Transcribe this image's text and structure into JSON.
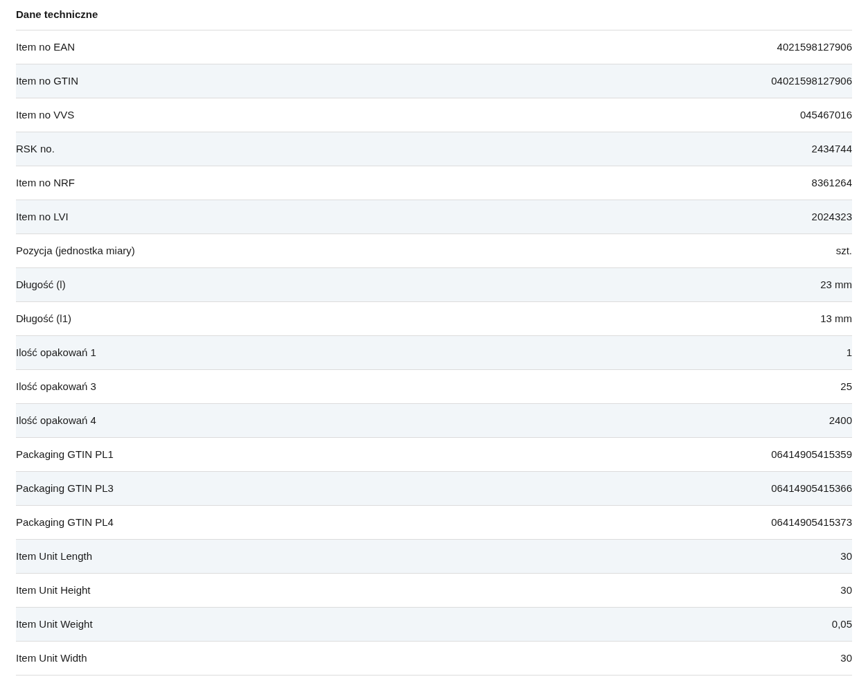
{
  "title": "Dane techniczne",
  "rows": [
    {
      "label": "Item no EAN",
      "value": "4021598127906"
    },
    {
      "label": "Item no GTIN",
      "value": "04021598127906"
    },
    {
      "label": "Item no VVS",
      "value": "045467016"
    },
    {
      "label": "RSK no.",
      "value": "2434744"
    },
    {
      "label": "Item no NRF",
      "value": "8361264"
    },
    {
      "label": "Item no LVI",
      "value": "2024323"
    },
    {
      "label": "Pozycja (jednostka miary)",
      "value": "szt."
    },
    {
      "label": "Długość (l)",
      "value": "23 mm"
    },
    {
      "label": "Długość (l1)",
      "value": "13 mm"
    },
    {
      "label": "Ilość opakowań 1",
      "value": "1"
    },
    {
      "label": "Ilość opakowań 3",
      "value": "25"
    },
    {
      "label": "Ilość opakowań 4",
      "value": "2400"
    },
    {
      "label": "Packaging GTIN PL1",
      "value": "06414905415359"
    },
    {
      "label": "Packaging GTIN PL3",
      "value": "06414905415366"
    },
    {
      "label": "Packaging GTIN PL4",
      "value": "06414905415373"
    },
    {
      "label": "Item Unit Length",
      "value": "30"
    },
    {
      "label": "Item Unit Height",
      "value": "30"
    },
    {
      "label": "Item Unit Weight",
      "value": "0,05"
    },
    {
      "label": "Item Unit Width",
      "value": "30"
    }
  ]
}
